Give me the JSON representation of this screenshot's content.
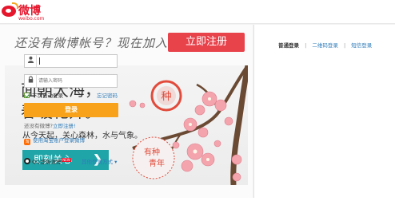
{
  "header": {
    "logo_name": "微博",
    "logo_url": "weibo.com"
  },
  "register": {
    "prompt": "还没有微博帐号？现在加入",
    "button_label": "立即注册"
  },
  "banner": {
    "title_line1": "面朝大海，",
    "title_line2": "春暖花开。",
    "subtitle": "从今天起，关心森林，水与气象。",
    "button_label": "即刻关心",
    "button_arrow": "❯",
    "stamp_top": "种",
    "stamp_text1": "有种",
    "stamp_text2": "青年"
  },
  "login": {
    "tabs": [
      "普通登录",
      "二维码登录",
      "短信登录"
    ],
    "tab_separator": "|",
    "username_icon": "user-icon",
    "username_value": "",
    "password_icon": "lock-icon",
    "password_placeholder": "请输入密码",
    "remember_label": "下次自动登录",
    "forgot_label": "忘记密码",
    "submit_label": "登录",
    "no_account_text": "还没有微博?",
    "register_link": "立即注册!",
    "taobao_label": "使用淘宝账户登录微博",
    "taobao_icon_text": "淘",
    "qq_label": "QQ登录微博",
    "qq_badge": "NEW",
    "other_label": "其他登录方式 ▾"
  },
  "colors": {
    "brand_red": "#e6162d",
    "register_red": "#e8424b",
    "login_orange": "#f7a21a",
    "teal": "#1fa5a8",
    "link_blue": "#2f7cba"
  }
}
